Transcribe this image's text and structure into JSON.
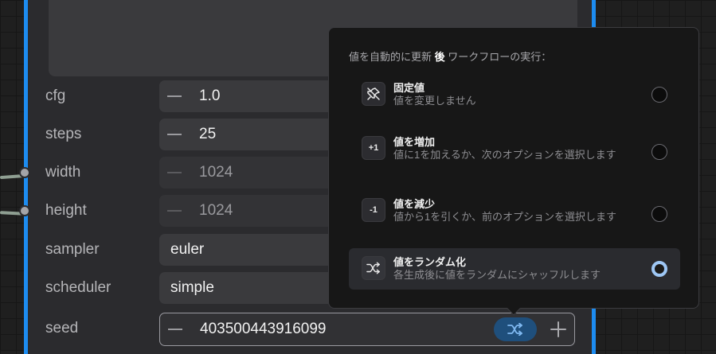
{
  "node": {
    "widgets": [
      {
        "label": "cfg",
        "value": "1.0",
        "disabled": false
      },
      {
        "label": "steps",
        "value": "25",
        "disabled": false
      },
      {
        "label": "width",
        "value": "1024",
        "disabled": true
      },
      {
        "label": "height",
        "value": "1024",
        "disabled": true
      }
    ],
    "sampler": {
      "label": "sampler",
      "value": "euler"
    },
    "scheduler": {
      "label": "scheduler",
      "value": "simple"
    },
    "seed": {
      "label": "seed",
      "value": "403500443916099"
    }
  },
  "popover": {
    "header_before": "値を自動的に更新",
    "header_bold": "後",
    "header_after": "ワークフローの実行：",
    "options": [
      {
        "icon": "pin-off-icon",
        "title": "固定値",
        "desc": "値を変更しません",
        "checked": false
      },
      {
        "icon": "plus-one-icon",
        "icon_text": "+1",
        "title": "値を増加",
        "desc": "値に1を加えるか、次のオプションを選択します",
        "checked": false
      },
      {
        "icon": "minus-one-icon",
        "icon_text": "-1",
        "title": "値を減少",
        "desc": "値から1を引くか、前のオプションを選択します",
        "checked": false
      },
      {
        "icon": "shuffle-icon",
        "title": "値をランダム化",
        "desc": "各生成後に値をランダムにシャッフルします",
        "checked": true
      }
    ]
  },
  "colors": {
    "accent": "#1d8cf0",
    "radio_checked": "#9ec7f5",
    "shuffle_bg": "#1f4f7c"
  }
}
